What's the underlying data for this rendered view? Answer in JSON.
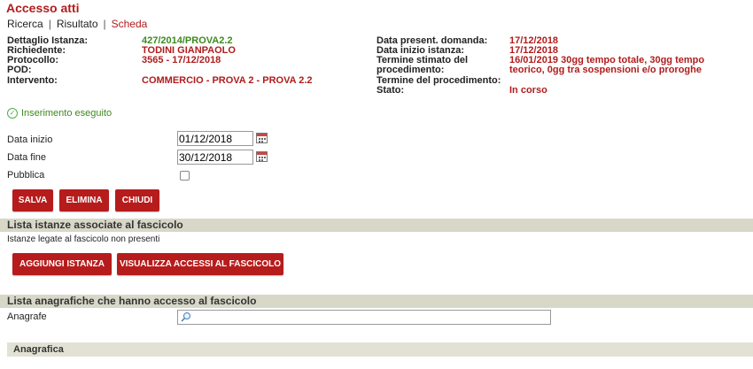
{
  "page": {
    "title": "Accesso atti"
  },
  "breadcrumb": {
    "items": [
      "Ricerca",
      "Risultato"
    ],
    "current": "Scheda"
  },
  "details": {
    "left": [
      {
        "label": "Dettaglio Istanza:",
        "value": "427/2014/PROVA2.2"
      },
      {
        "label": "Richiedente:",
        "value": "TODINI GIANPAOLO"
      },
      {
        "label": "Protocollo:",
        "value": "3565 - 17/12/2018"
      },
      {
        "label": "POD:",
        "value": ""
      },
      {
        "label": "Intervento:",
        "value": "COMMERCIO - PROVA 2 - PROVA 2.2"
      }
    ],
    "right": [
      {
        "label": "Data present. domanda:",
        "value": "17/12/2018"
      },
      {
        "label": "Data inizio istanza:",
        "value": "17/12/2018"
      },
      {
        "label": "Termine stimato del",
        "value": "16/01/2019  30gg tempo totale, 30gg tempo"
      },
      {
        "label": "procedimento:",
        "value": "teorico, 0gg tra sospensioni e/o proroghe"
      },
      {
        "label": "Termine del procedimento:",
        "value": ""
      },
      {
        "label": "Stato:",
        "value": "In corso"
      }
    ]
  },
  "status": {
    "message": "Inserimento eseguito",
    "color": "#3c8a1e"
  },
  "form": {
    "data_inizio": {
      "label": "Data inizio",
      "value": "01/12/2018"
    },
    "data_fine": {
      "label": "Data fine",
      "value": "30/12/2018"
    },
    "pubblica": {
      "label": "Pubblica",
      "checked": false
    }
  },
  "buttons": {
    "salva": "SALVA",
    "elimina": "ELIMINA",
    "chiudi": "CHIUDI"
  },
  "istanze": {
    "header": "Lista istanze associate al fascicolo",
    "empty_text": "Istanze legate al fascicolo non presenti",
    "add_button": "AGGIUNGI ISTANZA",
    "view_button": "VISUALIZZA ACCESSI AL FASCICOLO"
  },
  "anagrafiche": {
    "header": "Lista anagrafiche che hanno accesso al fascicolo",
    "field_label": "Anagrafe",
    "field_value": "",
    "table_header": "Anagrafica"
  },
  "colors": {
    "accent": "#b71c1c",
    "section_bg": "#d8d8c8"
  },
  "icons": {
    "status": "check-circle-icon",
    "calendar": "calendar-icon",
    "search": "search-icon"
  }
}
